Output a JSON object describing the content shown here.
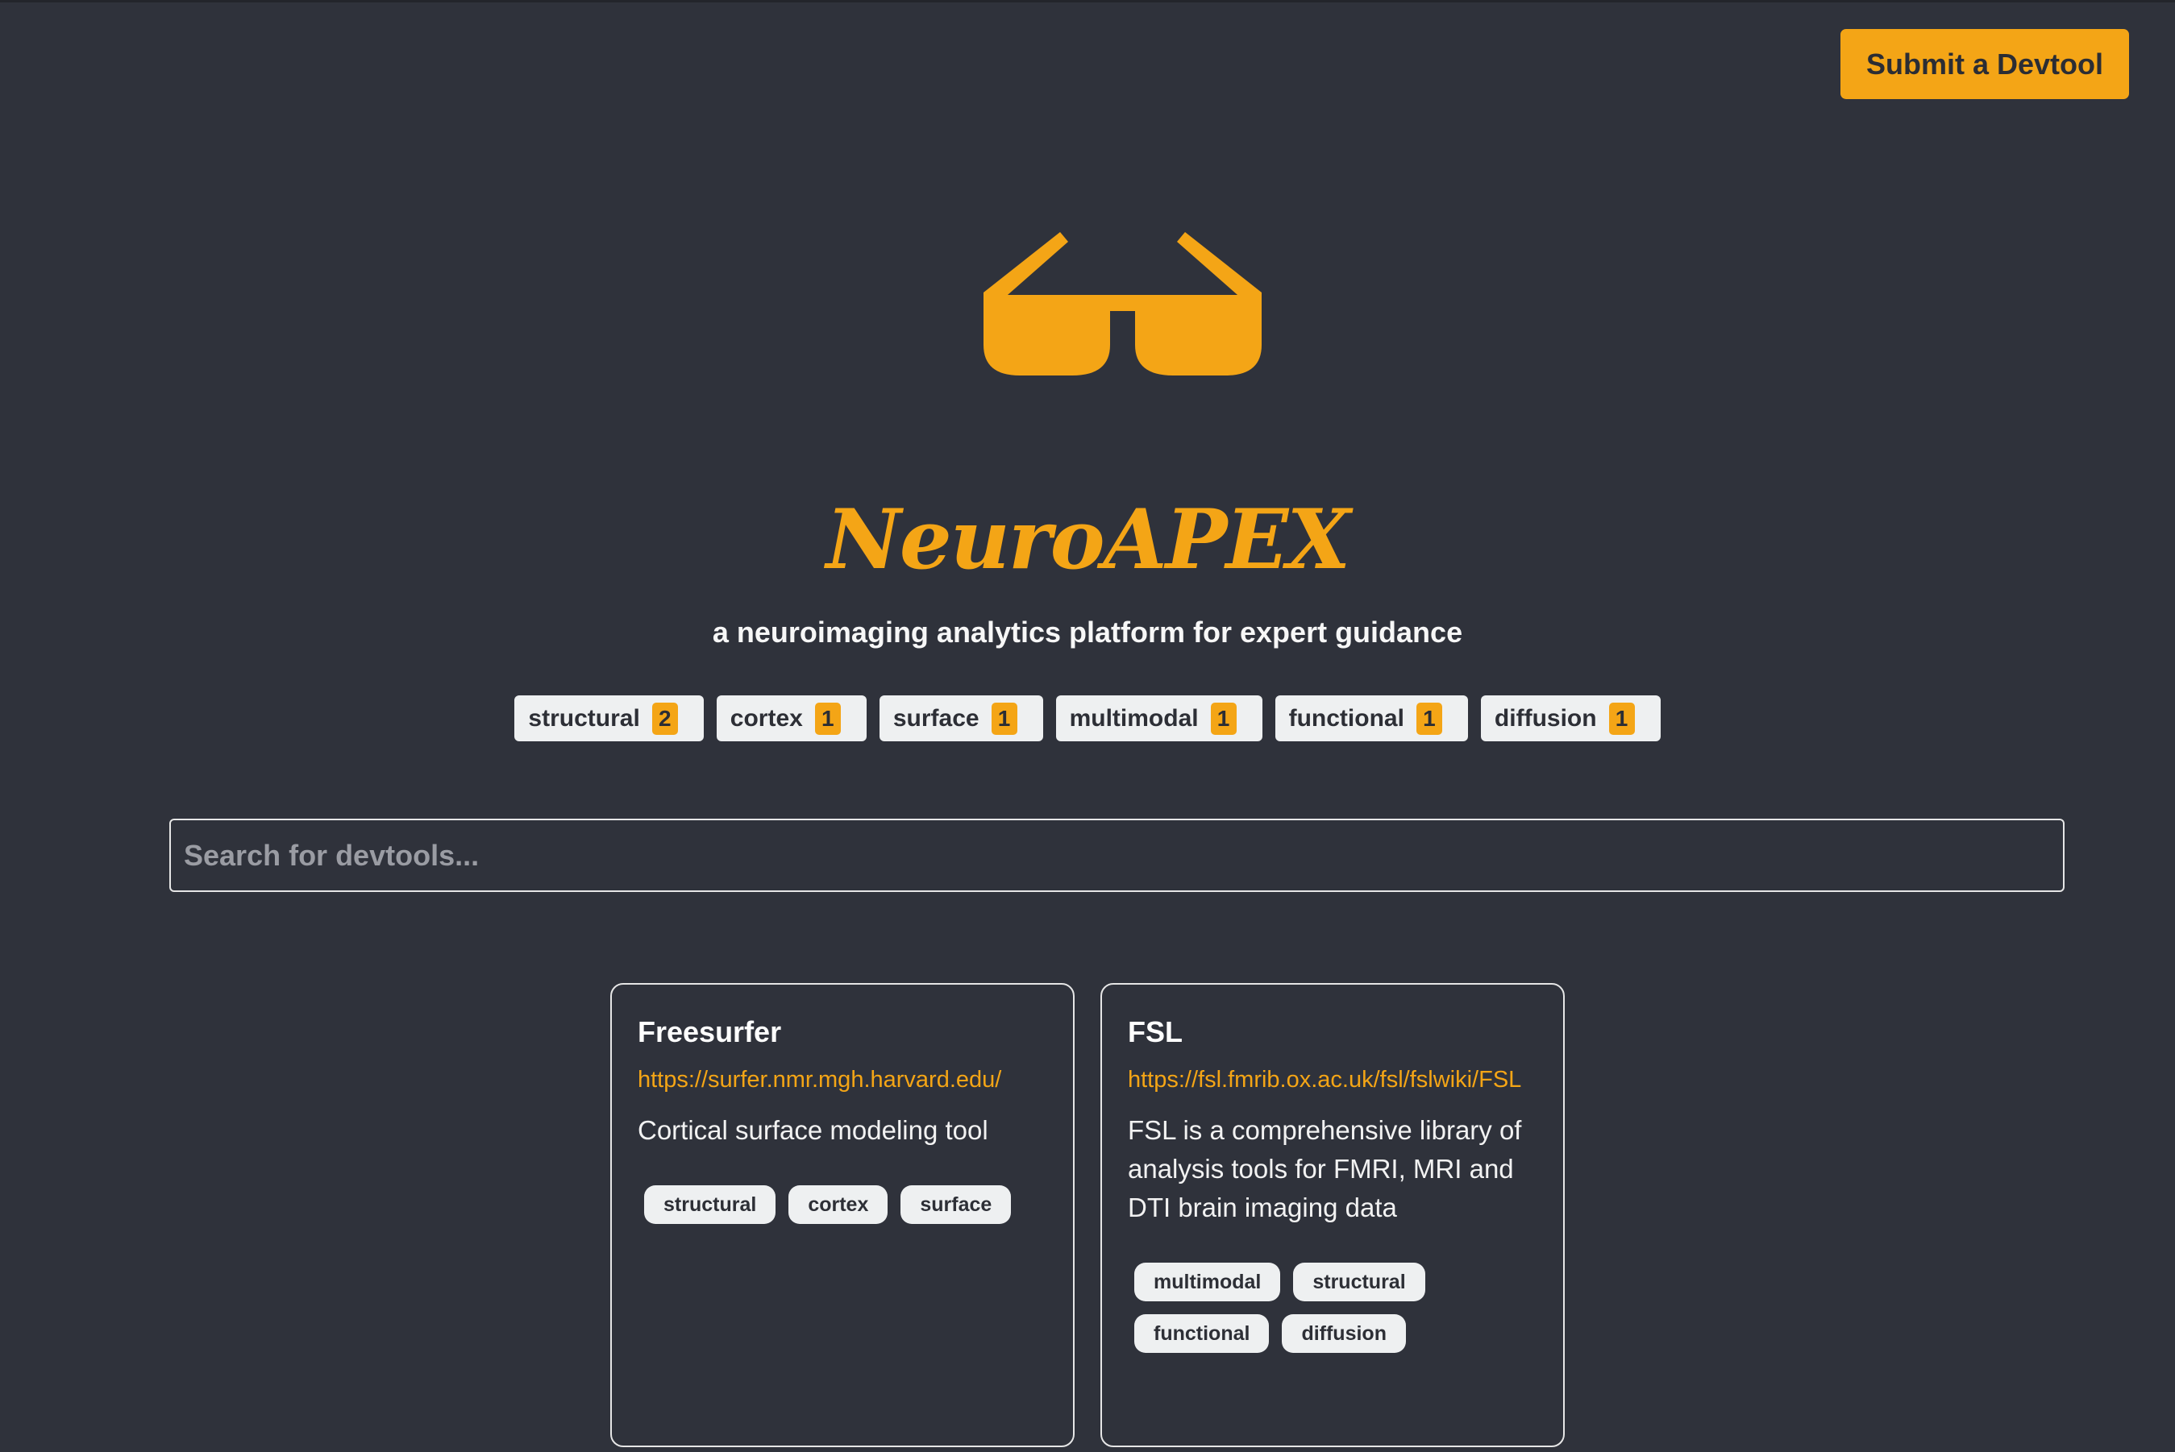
{
  "header": {
    "submit_label": "Submit a Devtool"
  },
  "brand": {
    "title": "NeuroAPEX",
    "tagline": "a neuroimaging analytics platform for expert guidance",
    "logo_icon": "sunglasses-icon",
    "accent_color": "#f4a516"
  },
  "filters": [
    {
      "label": "structural",
      "count": "2"
    },
    {
      "label": "cortex",
      "count": "1"
    },
    {
      "label": "surface",
      "count": "1"
    },
    {
      "label": "multimodal",
      "count": "1"
    },
    {
      "label": "functional",
      "count": "1"
    },
    {
      "label": "diffusion",
      "count": "1"
    }
  ],
  "search": {
    "placeholder": "Search for devtools...",
    "value": ""
  },
  "tools": [
    {
      "name": "Freesurfer",
      "url": "https://surfer.nmr.mgh.harvard.edu/",
      "description": "Cortical surface modeling tool",
      "tags": [
        "structural",
        "cortex",
        "surface"
      ]
    },
    {
      "name": "FSL",
      "url": "https://fsl.fmrib.ox.ac.uk/fsl/fslwiki/FSL",
      "description": "FSL is a comprehensive library of analysis tools for FMRI, MRI and DTI brain imaging data",
      "tags": [
        "multimodal",
        "structural",
        "functional",
        "diffusion"
      ]
    }
  ]
}
